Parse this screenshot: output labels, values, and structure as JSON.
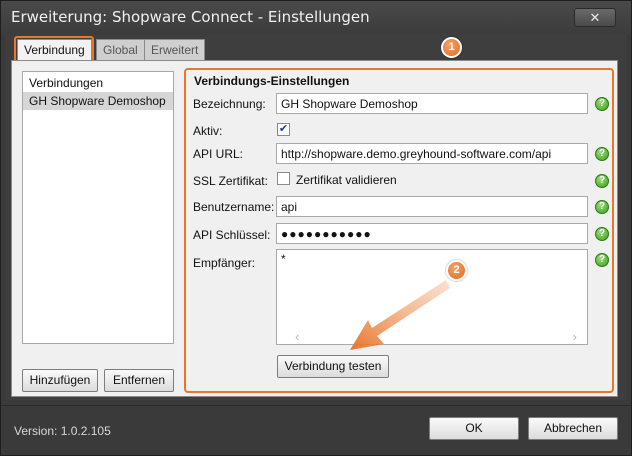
{
  "window": {
    "title": "Erweiterung: Shopware Connect - Einstellungen",
    "close_label": "✕"
  },
  "tabs": [
    {
      "label": "Verbindung",
      "active": true
    },
    {
      "label": "Global",
      "active": false
    },
    {
      "label": "Erweitert",
      "active": false
    }
  ],
  "connections": {
    "header": "Verbindungen",
    "items": [
      "GH Shopware Demoshop"
    ],
    "add_label": "Hinzufügen",
    "remove_label": "Entfernen"
  },
  "settings": {
    "title": "Verbindungs-Einstellungen",
    "name_label": "Bezeichnung:",
    "name_value": "GH Shopware Demoshop",
    "active_label": "Aktiv:",
    "active_checked": true,
    "api_url_label": "API URL:",
    "api_url_value": "http://shopware.demo.greyhound-software.com/api",
    "ssl_label": "SSL Zertifikat:",
    "ssl_checkbox_label": "Zertifikat validieren",
    "ssl_checked": false,
    "username_label": "Benutzername:",
    "username_value": "api",
    "api_key_label": "API Schlüssel:",
    "api_key_value": "●●●●●●●●●●●",
    "recipient_label": "Empfänger:",
    "recipient_value": "*",
    "test_button_label": "Verbindung testen"
  },
  "annotations": {
    "badge_1": "1",
    "badge_2": "2",
    "accent_color": "#e8762b"
  },
  "footer": {
    "version": "Version: 1.0.2.105",
    "ok_label": "OK",
    "cancel_label": "Abbrechen"
  },
  "icons": {
    "help": "help-icon",
    "check": "✔",
    "scroll_left": "‹",
    "scroll_right": "›"
  }
}
